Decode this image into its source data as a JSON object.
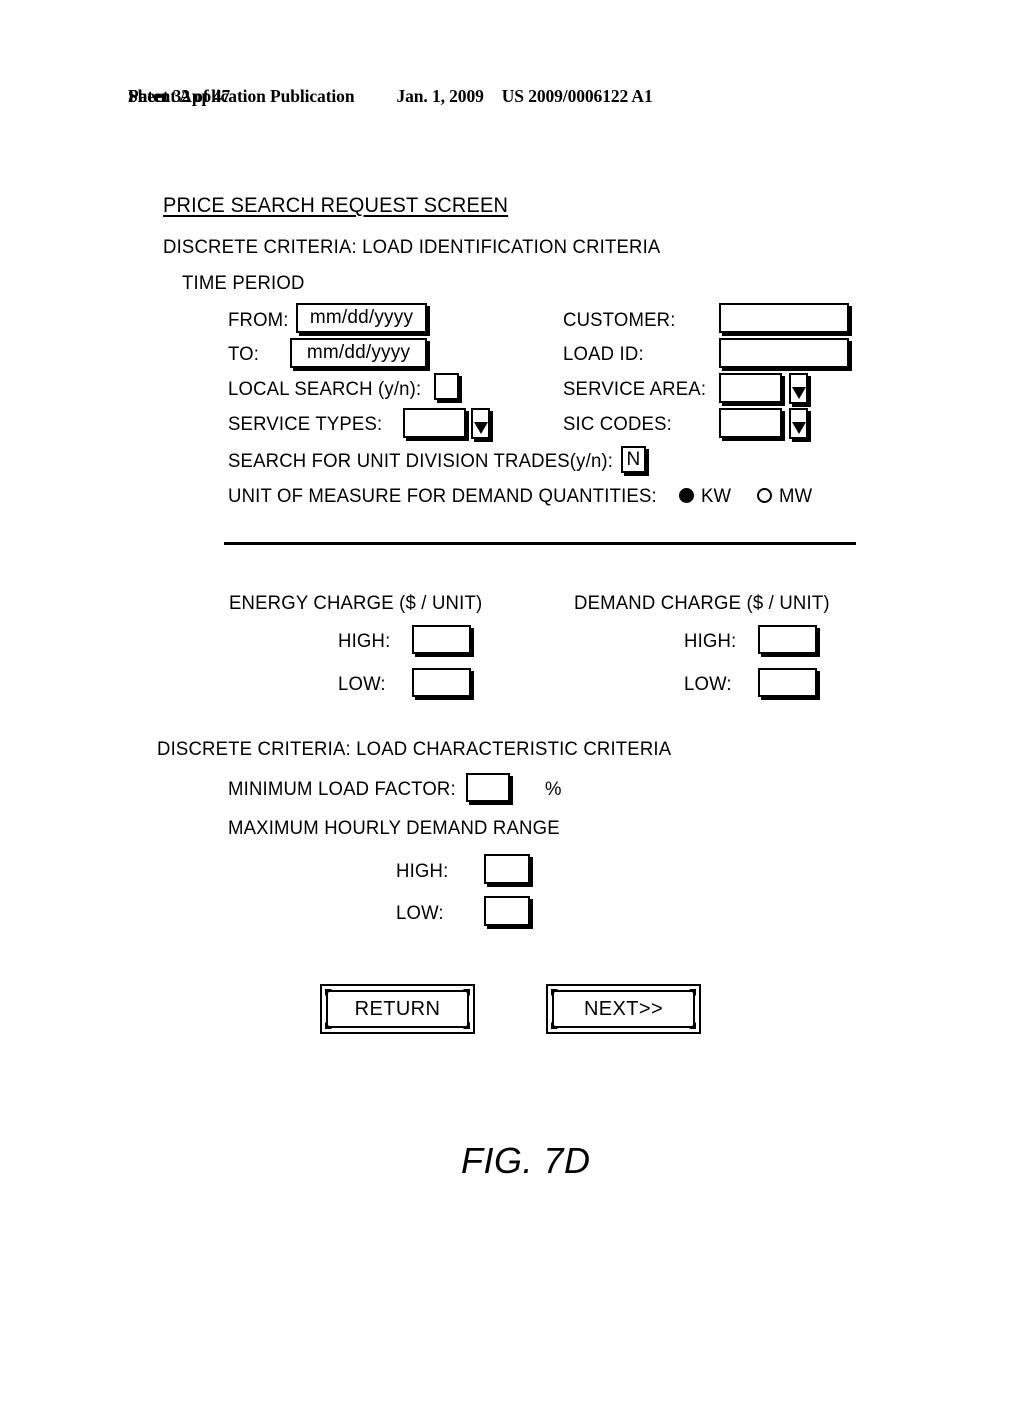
{
  "patent_header": {
    "publication": "Patent Application Publication",
    "date": "Jan. 1, 2009",
    "sheet": "Sheet 32 of 47",
    "doc_number": "US 2009/0006122 A1"
  },
  "screen": {
    "title": "PRICE SEARCH REQUEST SCREEN",
    "section_identification": "DISCRETE CRITERIA: LOAD IDENTIFICATION CRITERIA",
    "time_period_label": "TIME PERIOD",
    "fields": {
      "from_label": "FROM:",
      "from_value": "mm/dd/yyyy",
      "to_label": "TO:",
      "to_value": "mm/dd/yyyy",
      "local_search_label": "LOCAL SEARCH (y/n):",
      "local_search_value": "",
      "service_types_label": "SERVICE TYPES:",
      "service_types_value": "",
      "customer_label": "CUSTOMER:",
      "customer_value": "",
      "load_id_label": "LOAD ID:",
      "load_id_value": "",
      "service_area_label": "SERVICE AREA:",
      "service_area_value": "",
      "sic_codes_label": "SIC CODES:",
      "sic_codes_value": "",
      "unit_division_label": "SEARCH FOR UNIT DIVISION TRADES(y/n):",
      "unit_division_value": "N"
    },
    "unit_of_measure": {
      "label": "UNIT OF MEASURE FOR DEMAND QUANTITIES:",
      "options": [
        {
          "label": "KW",
          "selected": true
        },
        {
          "label": "MW",
          "selected": false
        }
      ]
    },
    "energy_charge": {
      "heading": "ENERGY CHARGE ($ / UNIT)",
      "high_label": "HIGH:",
      "high_value": "",
      "low_label": "LOW:",
      "low_value": ""
    },
    "demand_charge": {
      "heading": "DEMAND CHARGE ($ / UNIT)",
      "high_label": "HIGH:",
      "high_value": "",
      "low_label": "LOW:",
      "low_value": ""
    },
    "section_characteristic": "DISCRETE CRITERIA: LOAD CHARACTERISTIC CRITERIA",
    "load_characteristic": {
      "min_load_factor_label": "MINIMUM LOAD FACTOR:",
      "min_load_factor_value": "",
      "percent_symbol": "%",
      "max_hourly_demand_label": "MAXIMUM HOURLY DEMAND RANGE",
      "high_label": "HIGH:",
      "high_value": "",
      "low_label": "LOW:",
      "low_value": ""
    },
    "buttons": {
      "return_label": "RETURN",
      "next_label": "NEXT>>"
    }
  },
  "figure_caption": "FIG. 7D",
  "colors": {
    "ink": "#000000",
    "paper": "#ffffff"
  }
}
